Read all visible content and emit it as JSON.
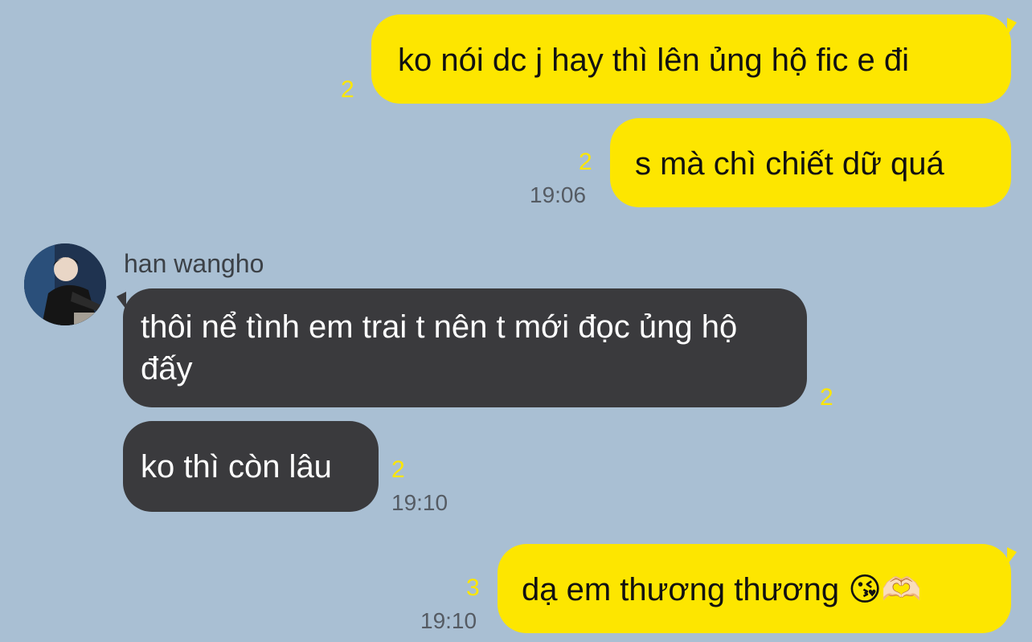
{
  "contact": {
    "name": "han wangho"
  },
  "messages": [
    {
      "direction": "outgoing",
      "text": "ko nói dc j hay thì lên ủng hộ fic e đi",
      "unread": "2",
      "time": ""
    },
    {
      "direction": "outgoing",
      "text": "s mà chì chiết dữ quá",
      "unread": "2",
      "time": "19:06"
    },
    {
      "direction": "incoming",
      "text": "thôi nể tình em trai t nên t mới đọc ủng hộ đấy",
      "unread": "2",
      "time": ""
    },
    {
      "direction": "incoming",
      "text": "ko thì còn lâu",
      "unread": "2",
      "time": "19:10"
    },
    {
      "direction": "outgoing",
      "text": "dạ em thương thương 😘🫶🏻",
      "unread": "3",
      "time": "19:10"
    }
  ],
  "colors": {
    "background": "#a9bfd3",
    "outgoing_bubble": "#fde600",
    "incoming_bubble": "#3a3a3d",
    "unread_count": "#fde600"
  }
}
